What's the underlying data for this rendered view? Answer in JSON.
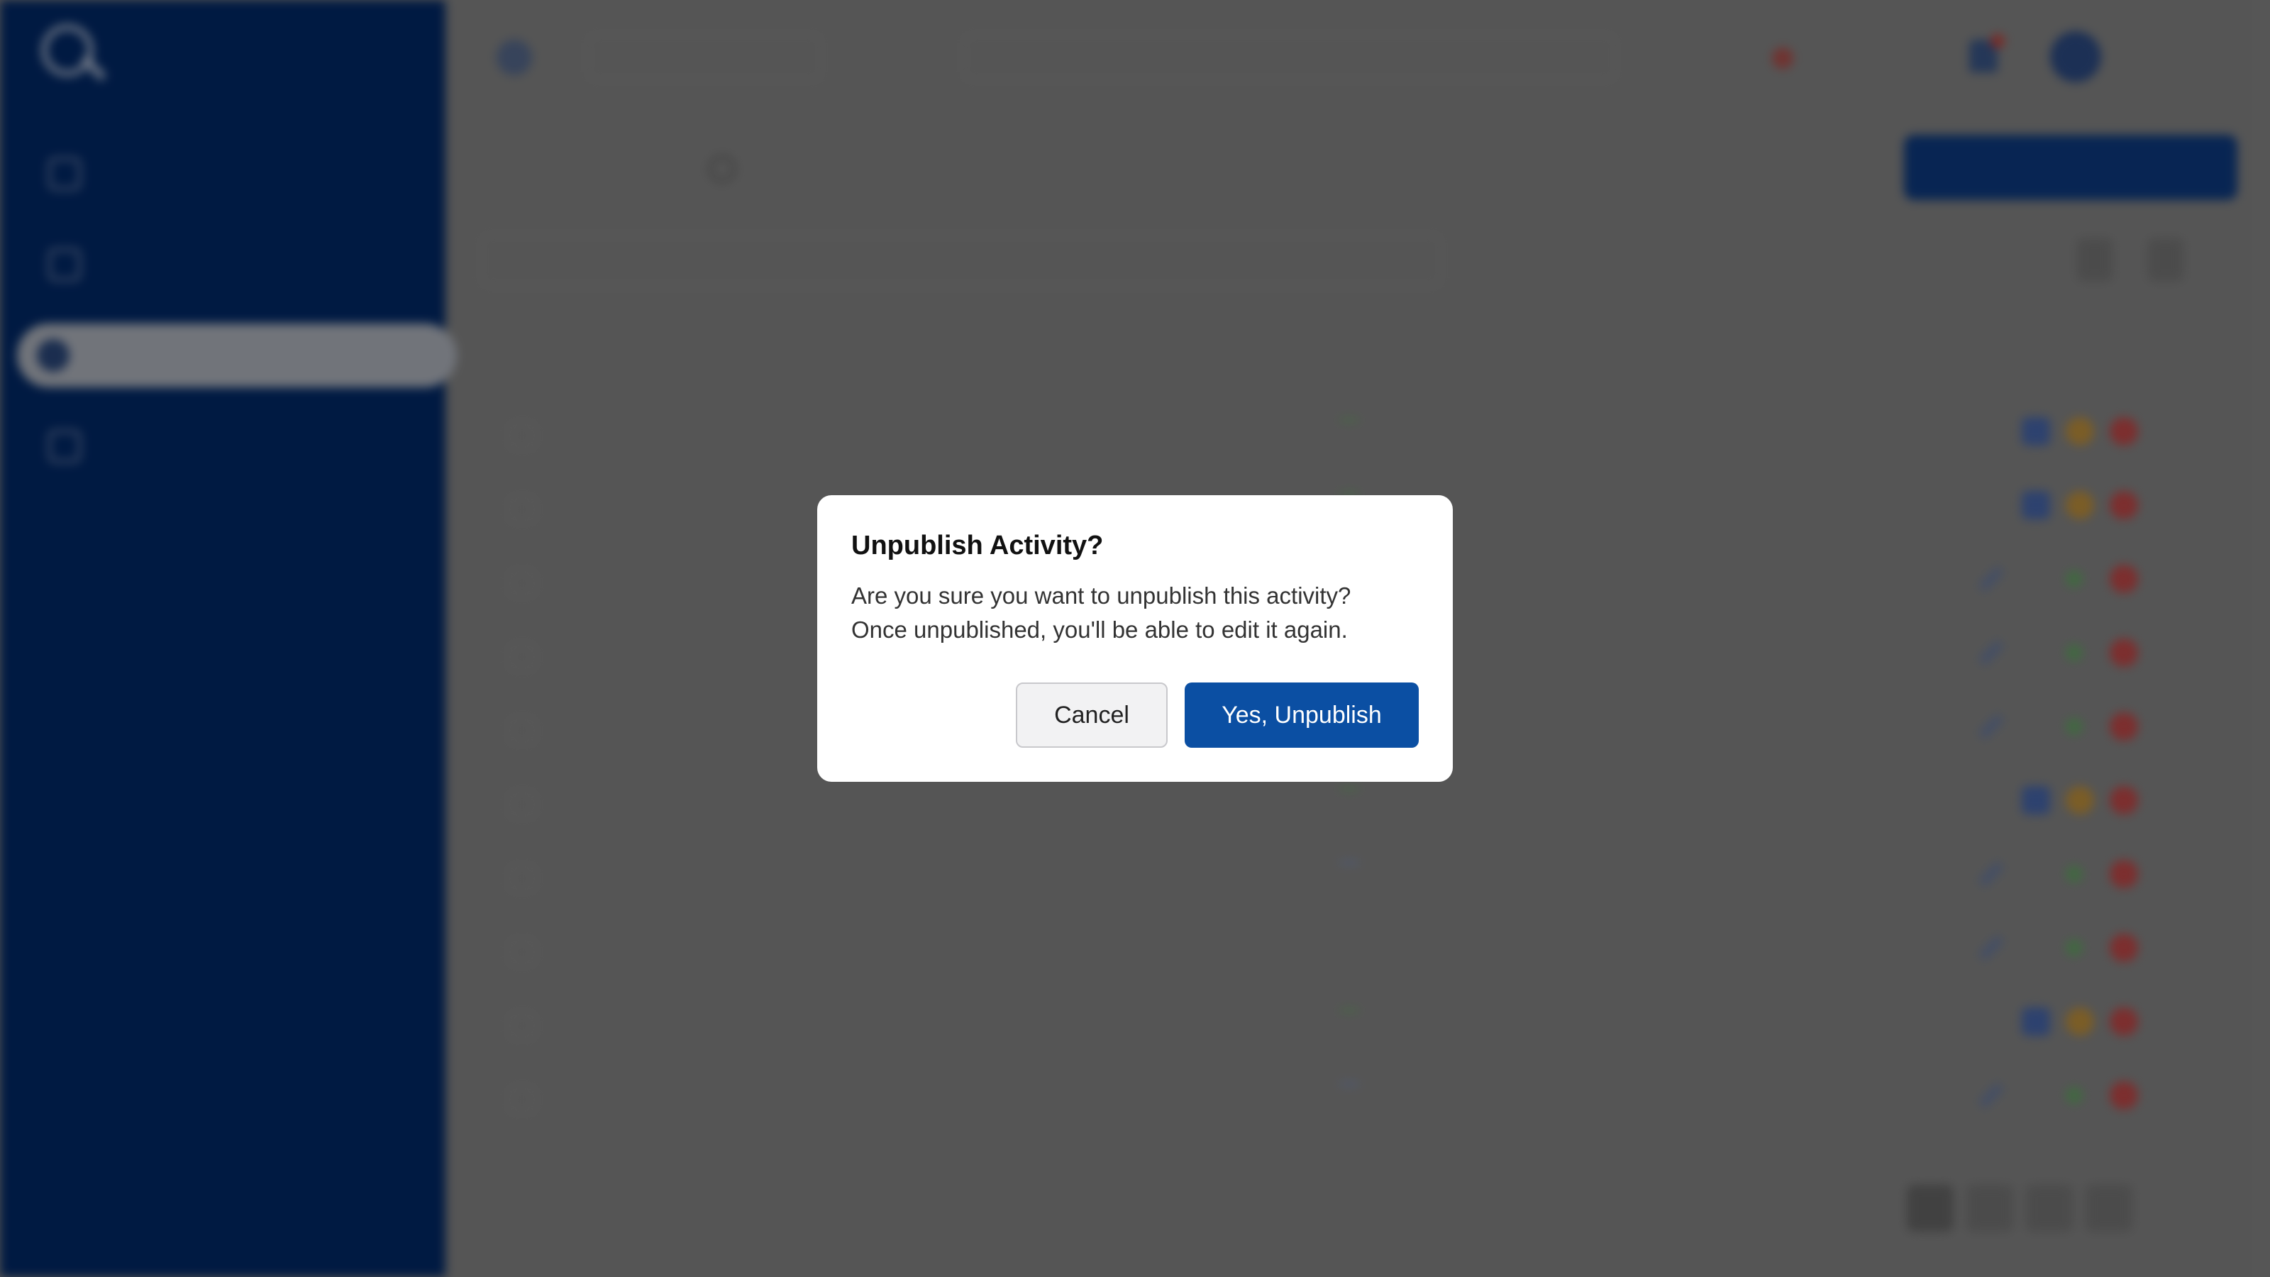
{
  "sidebar": {
    "logo_small": "",
    "logo_big": "",
    "items": [
      {
        "label": "",
        "icon": "grid-icon",
        "active": false
      },
      {
        "label": "",
        "icon": "list-icon",
        "active": false
      },
      {
        "label": "",
        "icon": "activity-icon",
        "active": true
      },
      {
        "label": "",
        "icon": "library-icon",
        "active": false
      }
    ]
  },
  "header": {
    "tenant": "",
    "search_placeholder": "",
    "language": "",
    "user_name": "",
    "user_role": ""
  },
  "page": {
    "title": "",
    "create_button": "",
    "filter_label": ""
  },
  "table": {
    "columns": [
      "",
      "",
      "",
      "",
      ""
    ],
    "rows": [
      {
        "name": "",
        "type": "",
        "status": "published",
        "date": "",
        "actions": [
          "view",
          "unpub",
          "del"
        ]
      },
      {
        "name": "",
        "type": "",
        "status": "published",
        "date": "",
        "actions": [
          "view",
          "unpub",
          "del"
        ]
      },
      {
        "name": "",
        "type": "",
        "status": "draft",
        "date": "",
        "actions": [
          "edit",
          "pub",
          "del"
        ]
      },
      {
        "name": "",
        "type": "",
        "status": "draft",
        "date": "",
        "actions": [
          "edit",
          "pub",
          "del"
        ]
      },
      {
        "name": "",
        "type": "",
        "status": "draft",
        "date": "",
        "actions": [
          "edit",
          "pub",
          "del"
        ]
      },
      {
        "name": "",
        "type": "",
        "status": "published",
        "date": "",
        "actions": [
          "view",
          "unpub",
          "del"
        ]
      },
      {
        "name": "",
        "type": "",
        "status": "draft",
        "date": "",
        "actions": [
          "edit",
          "pub",
          "del"
        ]
      },
      {
        "name": "",
        "type": "",
        "status": "unpublished",
        "date": "",
        "actions": [
          "edit",
          "pub",
          "del"
        ]
      },
      {
        "name": "",
        "type": "",
        "status": "published",
        "date": "",
        "actions": [
          "view",
          "unpub",
          "del"
        ]
      },
      {
        "name": "",
        "type": "",
        "status": "draft",
        "date": "",
        "actions": [
          "edit",
          "pub",
          "del"
        ]
      }
    ],
    "footer_text": ""
  },
  "dialog": {
    "title": "Unpublish Activity?",
    "message_line1": "Are you sure you want to unpublish this activity?",
    "message_line2": "Once unpublished, you'll be able to edit it again.",
    "cancel_label": "Cancel",
    "confirm_label": "Yes, Unpublish"
  },
  "colors": {
    "sidebar_bg": "#012a6b",
    "primary": "#0b4fa3",
    "overlay": "rgba(0,0,0,0.38)",
    "delete": "#c94b4b",
    "published": "#6fae6a",
    "draft": "#7e95c7"
  }
}
